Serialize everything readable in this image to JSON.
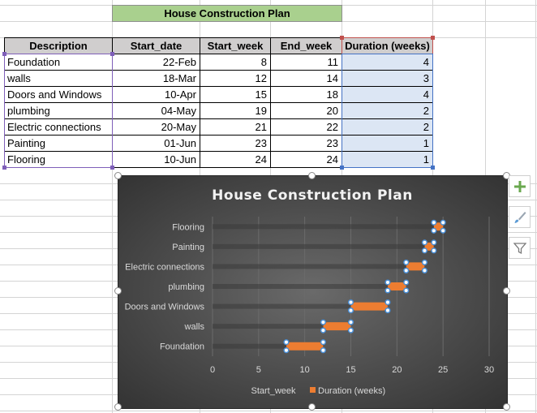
{
  "sheet": {
    "title": "House Construction Plan",
    "columns": [
      "Description",
      "Start_date",
      "Start_week",
      "End_week",
      "Duration (weeks)"
    ],
    "rows": [
      {
        "description": "Foundation",
        "start_date": "22-Feb",
        "start_week": "8",
        "end_week": "11",
        "duration": "4"
      },
      {
        "description": "walls",
        "start_date": "18-Mar",
        "start_week": "12",
        "end_week": "14",
        "duration": "3"
      },
      {
        "description": "Doors and Windows",
        "start_date": "10-Apr",
        "start_week": "15",
        "end_week": "18",
        "duration": "4"
      },
      {
        "description": "plumbing",
        "start_date": "04-May",
        "start_week": "19",
        "end_week": "20",
        "duration": "2"
      },
      {
        "description": "Electric connections",
        "start_date": "20-May",
        "start_week": "21",
        "end_week": "22",
        "duration": "2"
      },
      {
        "description": "Painting",
        "start_date": "01-Jun",
        "start_week": "23",
        "end_week": "23",
        "duration": "1"
      },
      {
        "description": "Flooring",
        "start_date": "10-Jun",
        "start_week": "24",
        "end_week": "24",
        "duration": "1"
      }
    ]
  },
  "chart_data": {
    "type": "bar",
    "orientation": "horizontal",
    "stacked": true,
    "title": "House Construction Plan",
    "categories": [
      "Foundation",
      "walls",
      "Doors and Windows",
      "plumbing",
      "Electric connections",
      "Painting",
      "Flooring"
    ],
    "series": [
      {
        "name": "Start_week",
        "values": [
          8,
          12,
          15,
          19,
          21,
          23,
          24
        ],
        "color": "none"
      },
      {
        "name": "Duration (weeks)",
        "values": [
          4,
          3,
          4,
          2,
          2,
          1,
          1
        ],
        "color": "#ed7d31"
      }
    ],
    "xlim": [
      0,
      30
    ],
    "xticks": [
      "0",
      "5",
      "10",
      "15",
      "20",
      "25",
      "30"
    ],
    "legend_position": "bottom",
    "grid": true,
    "selected_series": "Duration (weeks)"
  },
  "chart_tools": {
    "add_element_icon": "plus-icon",
    "style_icon": "brush-icon",
    "filter_icon": "filter-icon"
  }
}
